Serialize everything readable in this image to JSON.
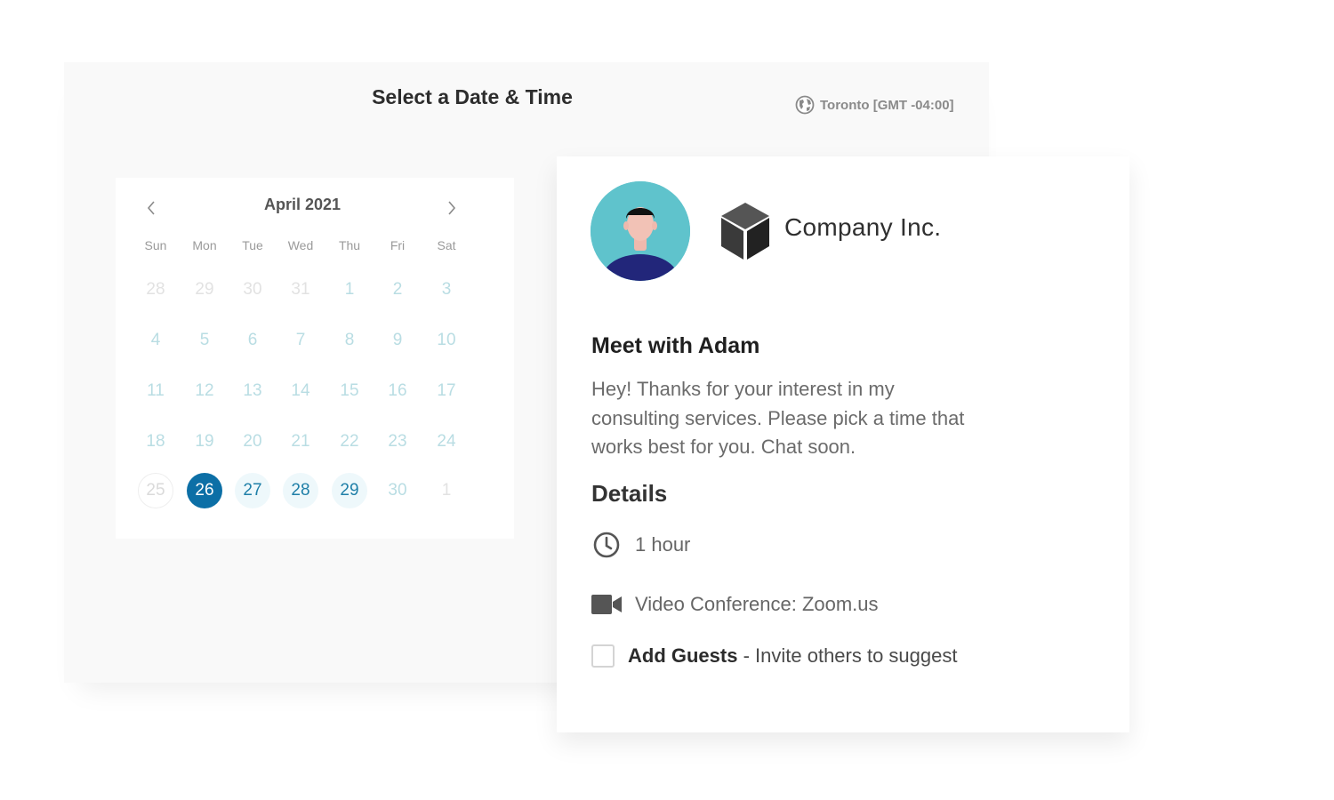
{
  "header": {
    "title": "Select a Date & Time",
    "timezone": "Toronto [GMT -04:00]"
  },
  "calendar": {
    "month_label": "April 2021",
    "weekdays": [
      "Sun",
      "Mon",
      "Tue",
      "Wed",
      "Thu",
      "Fri",
      "Sat"
    ],
    "weeks": [
      [
        {
          "d": "28",
          "s": "muted"
        },
        {
          "d": "29",
          "s": "muted"
        },
        {
          "d": "30",
          "s": "muted"
        },
        {
          "d": "31",
          "s": "muted"
        },
        {
          "d": "1",
          "s": "dim"
        },
        {
          "d": "2",
          "s": "dim"
        },
        {
          "d": "3",
          "s": "dim"
        }
      ],
      [
        {
          "d": "4",
          "s": "dim"
        },
        {
          "d": "5",
          "s": "dim"
        },
        {
          "d": "6",
          "s": "dim"
        },
        {
          "d": "7",
          "s": "dim"
        },
        {
          "d": "8",
          "s": "dim"
        },
        {
          "d": "9",
          "s": "dim"
        },
        {
          "d": "10",
          "s": "dim"
        }
      ],
      [
        {
          "d": "11",
          "s": "dim"
        },
        {
          "d": "12",
          "s": "dim"
        },
        {
          "d": "13",
          "s": "dim"
        },
        {
          "d": "14",
          "s": "dim"
        },
        {
          "d": "15",
          "s": "dim"
        },
        {
          "d": "16",
          "s": "dim"
        },
        {
          "d": "17",
          "s": "dim"
        }
      ],
      [
        {
          "d": "18",
          "s": "dim"
        },
        {
          "d": "19",
          "s": "dim"
        },
        {
          "d": "20",
          "s": "dim"
        },
        {
          "d": "21",
          "s": "dim"
        },
        {
          "d": "22",
          "s": "dim"
        },
        {
          "d": "23",
          "s": "dim"
        },
        {
          "d": "24",
          "s": "dim"
        }
      ],
      [
        {
          "d": "25",
          "s": "faint"
        },
        {
          "d": "26",
          "s": "selected"
        },
        {
          "d": "27",
          "s": "avail"
        },
        {
          "d": "28",
          "s": "avail"
        },
        {
          "d": "29",
          "s": "avail"
        },
        {
          "d": "30",
          "s": "dim"
        },
        {
          "d": "1",
          "s": "muted"
        }
      ]
    ],
    "selected_day": "26"
  },
  "event": {
    "company_name": "Company Inc.",
    "title": "Meet with Adam",
    "description": "Hey! Thanks for your interest in my consulting services. Please pick a time that works best for you. Chat soon.",
    "details_heading": "Details",
    "duration": "1 hour",
    "location": "Video Conference: Zoom.us",
    "guests_label": "Add Guests",
    "guests_hint": " - Invite others to suggest",
    "guests_checked": false
  },
  "icons": {
    "timezone": "globe-icon",
    "prev": "chevron-left-icon",
    "next": "chevron-right-icon",
    "duration": "clock-icon",
    "location": "video-camera-icon",
    "company": "cube-logo-icon"
  },
  "colors": {
    "selected_day": "#0c6fa6",
    "available_day_text": "#1f7fa8",
    "available_day_bg": "#eef8fb",
    "avatar_bg": "#5fc3cc"
  }
}
